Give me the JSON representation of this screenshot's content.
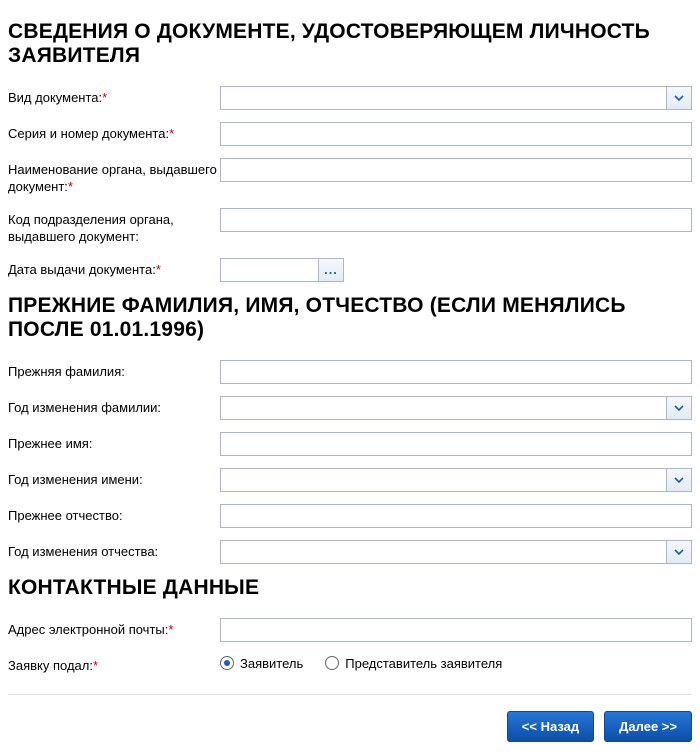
{
  "section1": {
    "heading": "СВЕДЕНИЯ О ДОКУМЕНТЕ, УДОСТОВЕРЯЮЩЕМ ЛИЧНОСТЬ ЗАЯВИТЕЛЯ",
    "doc_type_label": "Вид документа:",
    "doc_type_value": "",
    "series_label": "Серия и номер документа:",
    "series_value": "",
    "issuer_label": "Наименование органа, выдавшего документ:",
    "issuer_value": "",
    "dept_code_label": "Код подразделения органа, выдавшего документ:",
    "dept_code_value": "",
    "issue_date_label": "Дата выдачи документа:",
    "issue_date_value": ""
  },
  "section2": {
    "heading": "ПРЕЖНИЕ ФАМИЛИЯ, ИМЯ, ОТЧЕСТВО (ЕСЛИ МЕНЯЛИСЬ ПОСЛЕ 01.01.1996)",
    "prev_surname_label": "Прежняя фамилия:",
    "prev_surname_value": "",
    "surname_year_label": "Год изменения фамилии:",
    "surname_year_value": "",
    "prev_name_label": "Прежнее имя:",
    "prev_name_value": "",
    "name_year_label": "Год изменения имени:",
    "name_year_value": "",
    "prev_patr_label": "Прежнее отчество:",
    "prev_patr_value": "",
    "patr_year_label": "Год изменения отчества:",
    "patr_year_value": ""
  },
  "section3": {
    "heading": "КОНТАКТНЫЕ ДАННЫЕ",
    "email_label": "Адрес электронной почты:",
    "email_value": "",
    "submitted_label": "Заявку подал:",
    "radio_applicant": "Заявитель",
    "radio_representative": "Представитель заявителя",
    "selected": "applicant"
  },
  "buttons": {
    "back": "<< Назад",
    "next": "Далее >>"
  },
  "date_btn_glyph": "..."
}
